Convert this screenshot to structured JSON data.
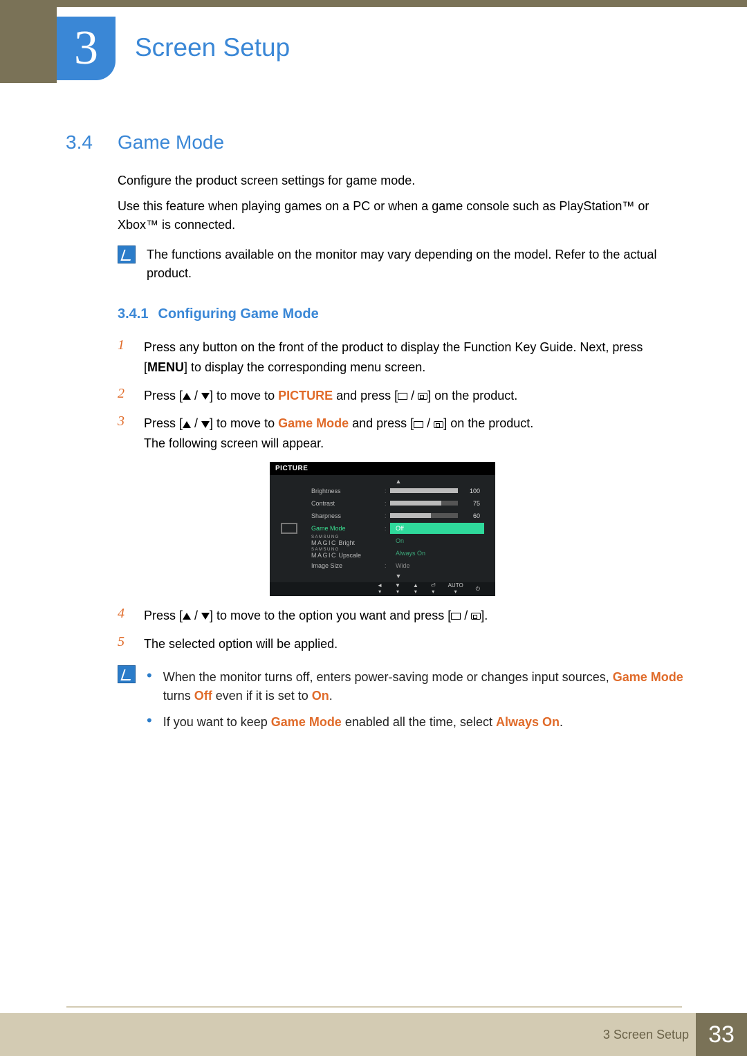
{
  "chapter": {
    "number": "3",
    "title": "Screen Setup"
  },
  "section": {
    "number": "3.4",
    "title": "Game Mode"
  },
  "intro": {
    "p1": "Configure the product screen settings for game mode.",
    "p2": "Use this feature when playing games on a PC or when a game console such as PlayStation™ or Xbox™ is connected."
  },
  "note1": "The functions available on the monitor may vary depending on the model. Refer to the actual product.",
  "subsection": {
    "number": "3.4.1",
    "title": "Configuring Game Mode"
  },
  "steps": {
    "s1a": "Press any button on the front of the product to display the Function Key Guide. Next, press [",
    "s1menu": "MENU",
    "s1b": "] to display the corresponding menu screen.",
    "s2a": "Press [",
    "s2b": "] to move to ",
    "s2hl": "PICTURE",
    "s2c": " and press [",
    "s2d": "] on the product.",
    "s3a": "Press [",
    "s3b": "] to move to ",
    "s3hl": "Game Mode",
    "s3c": " and press [",
    "s3d": "] on the product.",
    "s3e": "The following screen will appear.",
    "s4a": "Press [",
    "s4b": "] to move to the option you want and press [",
    "s4c": "].",
    "s5": "The selected option will be applied."
  },
  "osd": {
    "title": "PICTURE",
    "rows": [
      {
        "label": "Brightness",
        "value": "100",
        "fill": 100
      },
      {
        "label": "Contrast",
        "value": "75",
        "fill": 75
      },
      {
        "label": "Sharpness",
        "value": "60",
        "fill": 60
      }
    ],
    "gamemode_label": "Game Mode",
    "options": [
      "Off",
      "On",
      "Always On"
    ],
    "magic1_pre": "SAMSUNG",
    "magic1_main": "MAGIC",
    "magic1_suf": "Bright",
    "magic2_pre": "SAMSUNG",
    "magic2_main": "MAGIC",
    "magic2_suf": "Upscale",
    "imgsize_label": "Image Size",
    "imgsize_val": "Wide",
    "ctrl_auto": "AUTO"
  },
  "note2": {
    "b1a": "When the monitor turns off, enters power-saving mode or changes input sources, ",
    "b1hl1": "Game Mode",
    "b1b": " turns ",
    "b1hl2": "Off",
    "b1c": " even if it is set to ",
    "b1hl3": "On",
    "b1d": ".",
    "b2a": "If you want to keep ",
    "b2hl1": "Game Mode",
    "b2b": " enabled all the time, select ",
    "b2hl2": "Always On",
    "b2c": "."
  },
  "footer": {
    "label": "3 Screen Setup",
    "page": "33"
  }
}
